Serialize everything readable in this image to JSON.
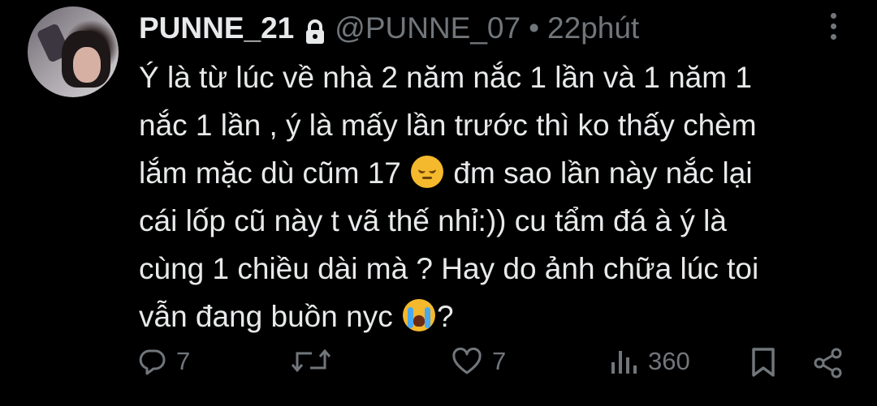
{
  "post": {
    "display_name": "PUNNE_21",
    "handle": "@PUNNE_07",
    "separator": "•",
    "time": "22phút",
    "text_lines": [
      "Ý là từ lúc về nhà 2 năm nắc 1 lần và 1 năm 1",
      "nắc 1 lần , ý là mấy lần trước thì ko thấy chèm",
      "lắm mặc dù cũm 17",
      "đm sao lần này nắc lại",
      "cái lốp cũ này t vã thế nhỉ:)) cu tẩm đá à ý là",
      "cùng 1 chiều dài mà ? Hay do ảnh chữa lúc toi",
      "vẫn đang buồn nyc",
      "?"
    ],
    "emojis": [
      "disappointed-face",
      "loudly-crying-face"
    ]
  },
  "actions": {
    "reply_count": "7",
    "repost_count": "",
    "like_count": "7",
    "view_count": "360"
  },
  "colors": {
    "background": "#000000",
    "text": "#e7e9ea",
    "muted": "#71767b"
  },
  "icons": [
    "lock-icon",
    "more-icon",
    "reply-icon",
    "repost-icon",
    "like-icon",
    "views-icon",
    "bookmark-icon",
    "share-icon"
  ]
}
